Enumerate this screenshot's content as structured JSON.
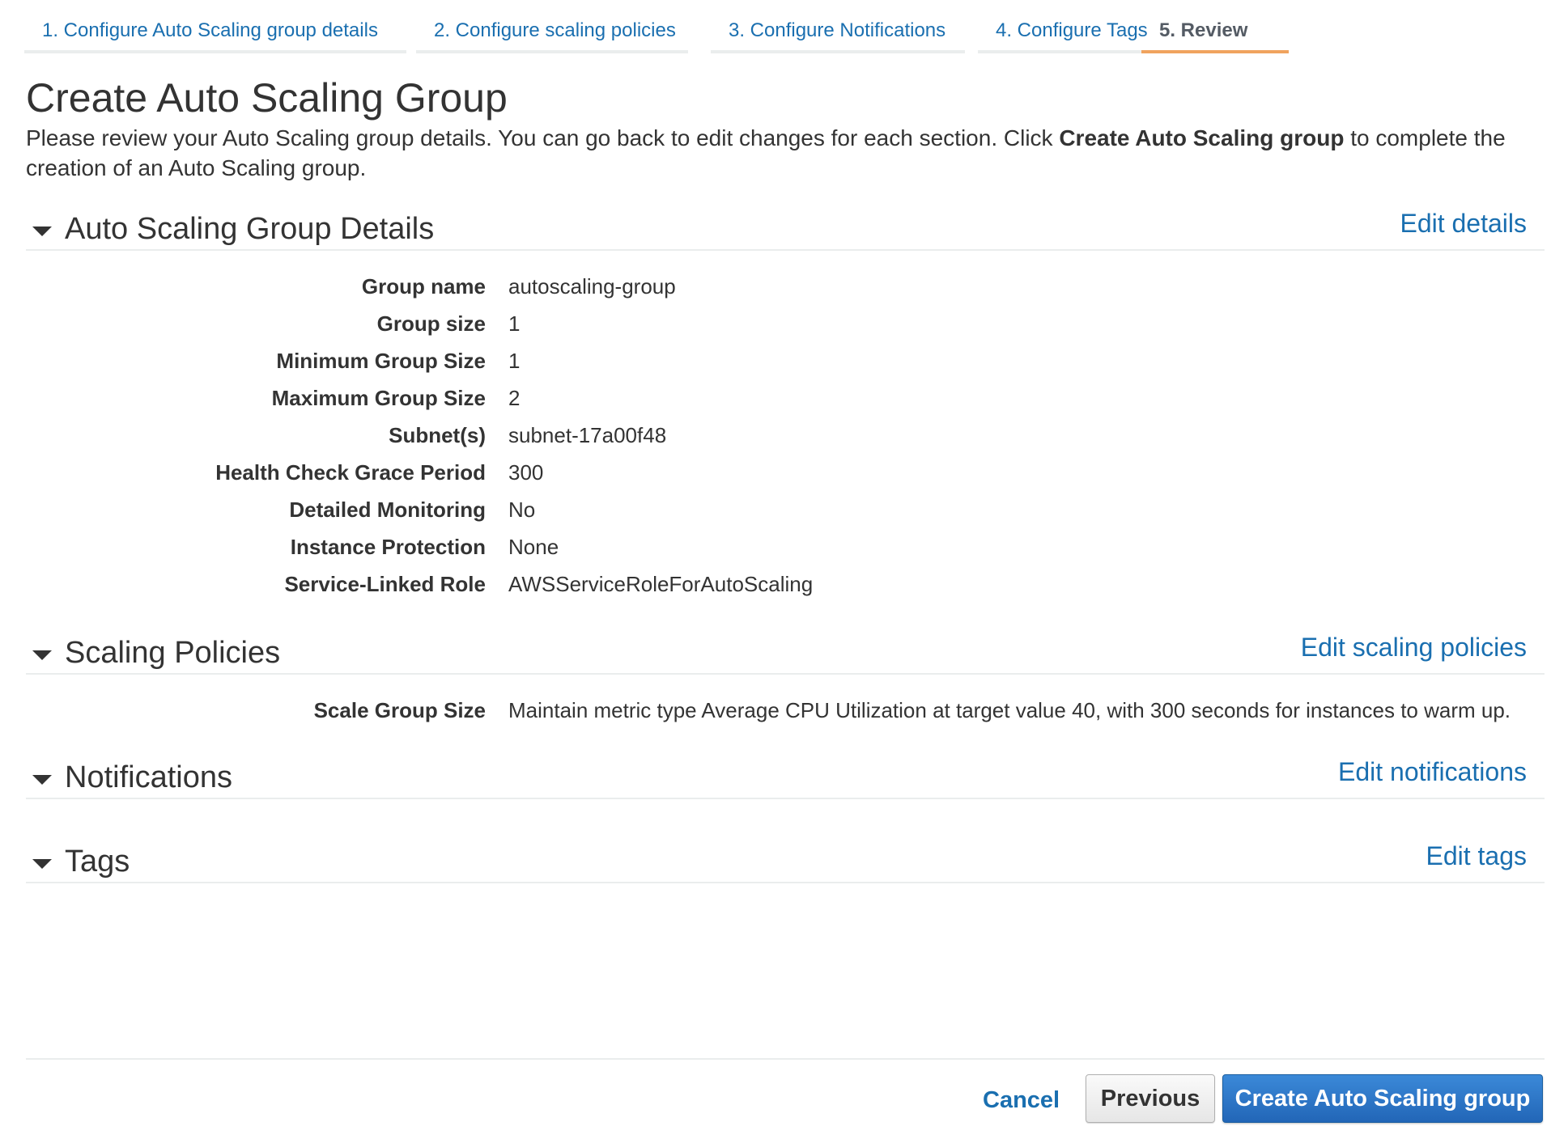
{
  "wizard": {
    "tabs": [
      {
        "label": "1. Configure Auto Scaling group details",
        "active": false
      },
      {
        "label": "2. Configure scaling policies",
        "active": false
      },
      {
        "label": "3. Configure Notifications",
        "active": false
      },
      {
        "label": "4. Configure Tags",
        "active": false
      },
      {
        "label": "5. Review",
        "active": true
      }
    ]
  },
  "page": {
    "title": "Create Auto Scaling Group",
    "description_before": "Please review your Auto Scaling group details. You can go back to edit changes for each section. Click ",
    "description_bold": "Create Auto Scaling group",
    "description_after": " to complete the creation of an Auto Scaling group."
  },
  "sections": {
    "details": {
      "title": "Auto Scaling Group Details",
      "edit_label": "Edit details",
      "rows": [
        {
          "label": "Group name",
          "value": "autoscaling-group"
        },
        {
          "label": "Group size",
          "value": "1"
        },
        {
          "label": "Minimum Group Size",
          "value": "1"
        },
        {
          "label": "Maximum Group Size",
          "value": "2"
        },
        {
          "label": "Subnet(s)",
          "value": "subnet-17a00f48"
        },
        {
          "label": "Health Check Grace Period",
          "value": "300"
        },
        {
          "label": "Detailed Monitoring",
          "value": "No"
        },
        {
          "label": "Instance Protection",
          "value": "None"
        },
        {
          "label": "Service-Linked Role",
          "value": "AWSServiceRoleForAutoScaling"
        }
      ]
    },
    "policies": {
      "title": "Scaling Policies",
      "edit_label": "Edit scaling policies",
      "rows": [
        {
          "label": "Scale Group Size",
          "value": "Maintain metric type Average CPU Utilization at target value 40, with 300 seconds for instances to warm up."
        }
      ]
    },
    "notifications": {
      "title": "Notifications",
      "edit_label": "Edit notifications"
    },
    "tags": {
      "title": "Tags",
      "edit_label": "Edit tags"
    }
  },
  "footer": {
    "cancel_label": "Cancel",
    "previous_label": "Previous",
    "create_label": "Create Auto Scaling group"
  },
  "colors": {
    "link": "#1a6fb0",
    "active_tab_underline": "#f0a35e",
    "primary_button": "#2266b7"
  }
}
